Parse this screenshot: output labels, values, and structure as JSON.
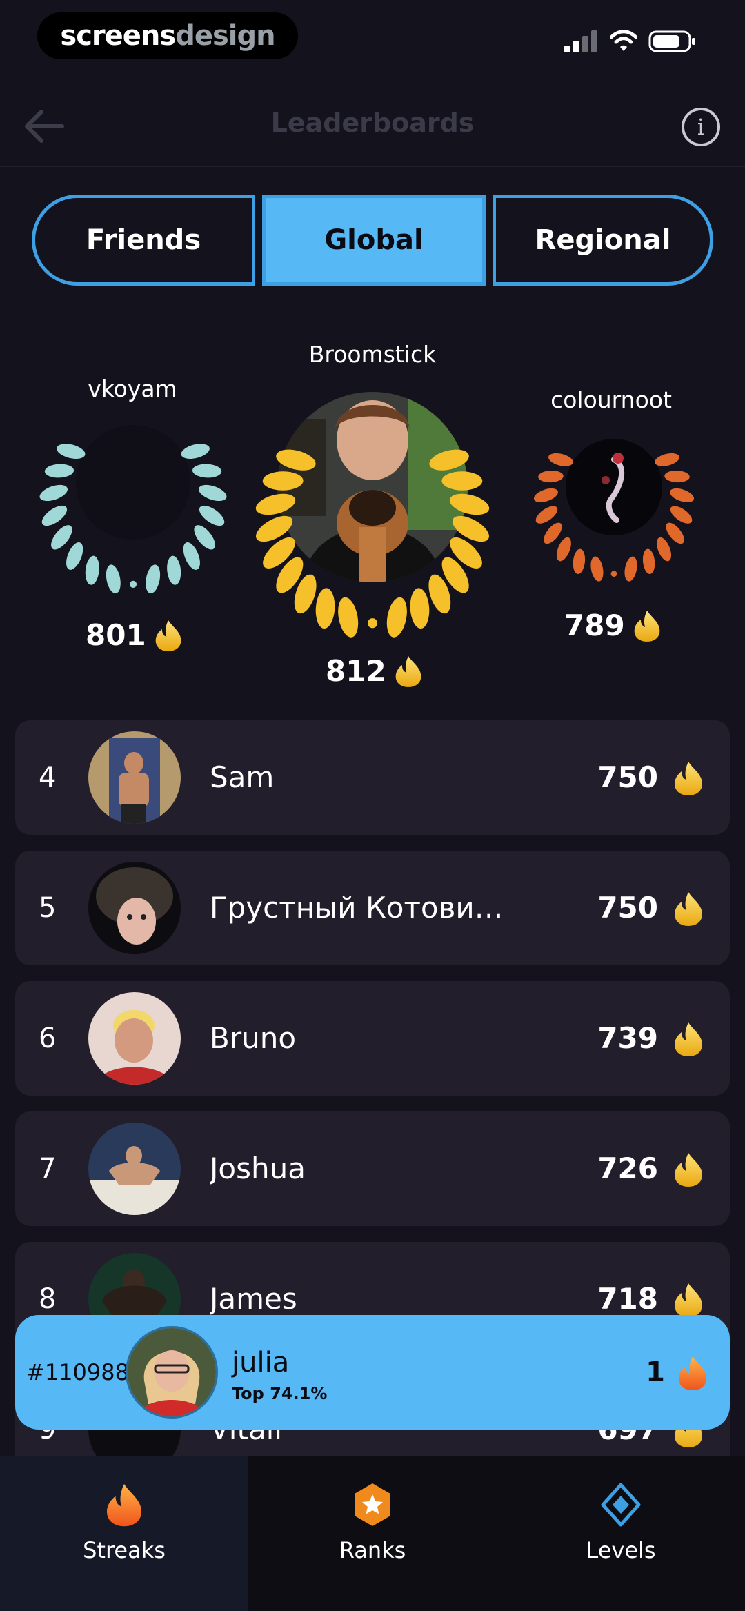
{
  "status_bar": {
    "brand_left": "screens",
    "brand_right": "design"
  },
  "header": {
    "title": "Leaderboards"
  },
  "tabs": [
    {
      "label": "Friends",
      "selected": false
    },
    {
      "label": "Global",
      "selected": true
    },
    {
      "label": "Regional",
      "selected": false
    }
  ],
  "podium": {
    "first": {
      "name": "Broomstick",
      "score": "812"
    },
    "second": {
      "name": "vkoyam",
      "score": "801"
    },
    "third": {
      "name": "colournoot",
      "score": "789"
    }
  },
  "leaderboard": [
    {
      "rank": "4",
      "name": "Sam",
      "score": "750"
    },
    {
      "rank": "5",
      "name": "Грустный Котови…",
      "score": "750"
    },
    {
      "rank": "6",
      "name": "Bruno",
      "score": "739"
    },
    {
      "rank": "7",
      "name": "Joshua",
      "score": "726"
    },
    {
      "rank": "8",
      "name": "James",
      "score": "718"
    },
    {
      "rank": "9",
      "name": "Vitali",
      "score": "697"
    }
  ],
  "current_user": {
    "rank": "#110988",
    "name": "julia",
    "top": "Top 74.1%",
    "score": "1"
  },
  "bottom_nav": [
    {
      "label": "Streaks",
      "icon": "flame-icon",
      "active": true
    },
    {
      "label": "Ranks",
      "icon": "star-badge-icon",
      "active": false
    },
    {
      "label": "Levels",
      "icon": "diamond-icon",
      "active": false
    }
  ],
  "colors": {
    "accent": "#56b8f4",
    "gold": "#f5c02a",
    "silver": "#9fd8d6",
    "bronze": "#e0682a",
    "background": "#14121c"
  }
}
